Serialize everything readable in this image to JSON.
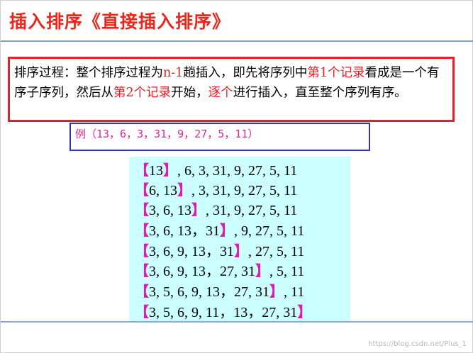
{
  "title": "插入排序《直接插入排序》",
  "description": {
    "parts": [
      {
        "text": "排序过程：整个排序过程为",
        "highlight": false
      },
      {
        "text": "n-1",
        "highlight": true
      },
      {
        "text": "趟插入，即先将序列中",
        "highlight": false
      },
      {
        "text": "第1个记录",
        "highlight": true
      },
      {
        "text": "看成是一个有序子序列，然后从",
        "highlight": false
      },
      {
        "text": "第2个记录",
        "highlight": true
      },
      {
        "text": "开始，",
        "highlight": false
      },
      {
        "text": "逐个",
        "highlight": true
      },
      {
        "text": "进行插入，直至整个序列有序。",
        "highlight": false
      }
    ]
  },
  "example": "例（13，6，3，31，9，27，5，11）",
  "steps": [
    {
      "open": "【",
      "sorted": "13",
      "close": "】",
      "rest": ", 6, 3, 31, 9, 27, 5, 11"
    },
    {
      "open": "【",
      "sorted": "6, 13",
      "close": "】",
      "rest": ", 3, 31, 9, 27, 5, 11"
    },
    {
      "open": "【",
      "sorted": "3, 6, 13",
      "close": "】",
      "rest": ", 31, 9, 27, 5, 11"
    },
    {
      "open": "【",
      "sorted": "3, 6, 13，31",
      "close": "】",
      "rest": ", 9, 27, 5, 11"
    },
    {
      "open": "【",
      "sorted": "3, 6, 9, 13，31",
      "close": "】",
      "rest": ", 27, 5, 11"
    },
    {
      "open": "【",
      "sorted": "3, 6, 9, 13，27, 31",
      "close": "】",
      "rest": ", 5, 11"
    },
    {
      "open": "【",
      "sorted": "3, 5, 6, 9, 13，27, 31",
      "close": "】",
      "rest": ", 11"
    },
    {
      "open": "【",
      "sorted": "3, 5, 6, 9, 11，13，27, 31",
      "close": "】",
      "rest": ""
    }
  ],
  "watermark": "https://blog.csdn.net/Plus_1",
  "colors": {
    "title": "#e8281c",
    "highlight": "#ee1c25",
    "bracket": "#e01ab4",
    "example": "#e0249a",
    "sequence_bg": "#ccffff"
  }
}
